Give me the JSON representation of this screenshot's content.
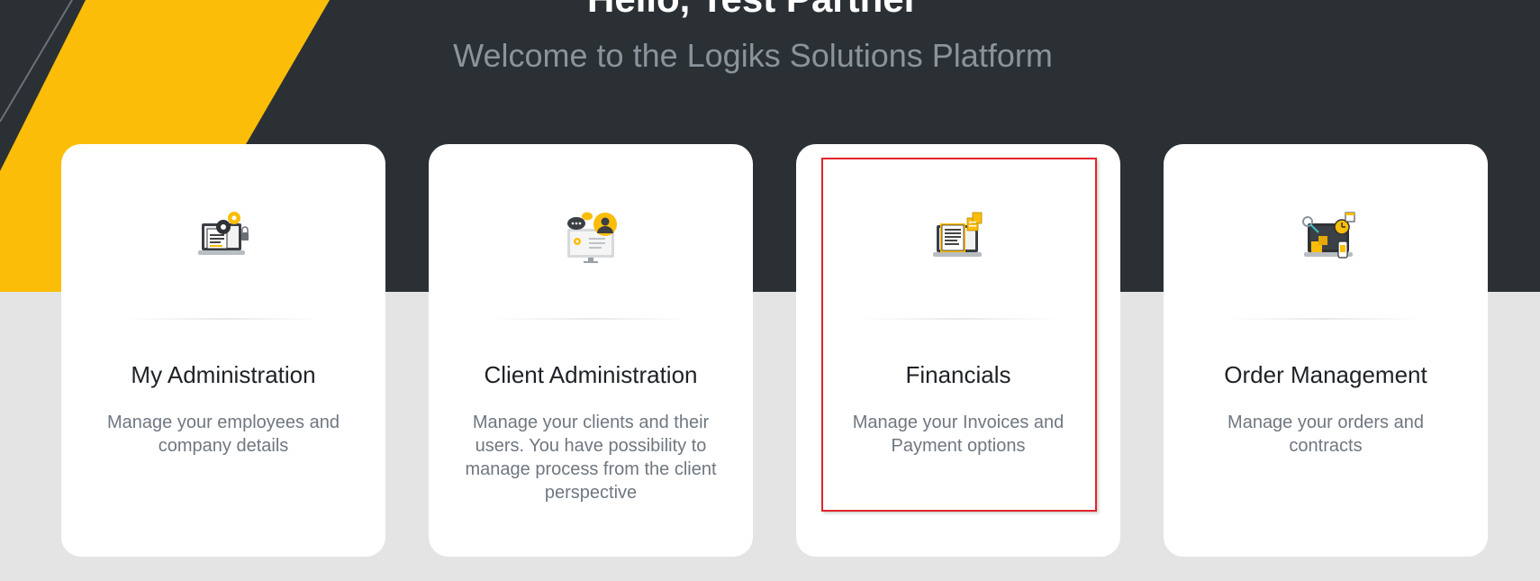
{
  "header": {
    "greeting": "Hello, Test Partner",
    "subtitle": "Welcome to the Logiks Solutions Platform"
  },
  "colors": {
    "hero_background": "#2b3034",
    "accent_yellow": "#fbbd08",
    "page_background": "#e4e4e4",
    "card_background": "#ffffff",
    "highlight_border": "#e0252b"
  },
  "cards": [
    {
      "title": "My Administration",
      "description": "Manage your employees and company details",
      "icon": "admin-laptop-gear-icon"
    },
    {
      "title": "Client Administration",
      "description": "Manage your clients and their users. You have possibility to manage process from the client perspective",
      "icon": "client-monitor-chat-icon"
    },
    {
      "title": "Financials",
      "description": "Manage your Invoices and Payment options",
      "icon": "financial-laptop-invoice-icon"
    },
    {
      "title": "Order Management",
      "description": "Manage your orders and contracts",
      "icon": "order-laptop-calendar-icon"
    }
  ]
}
